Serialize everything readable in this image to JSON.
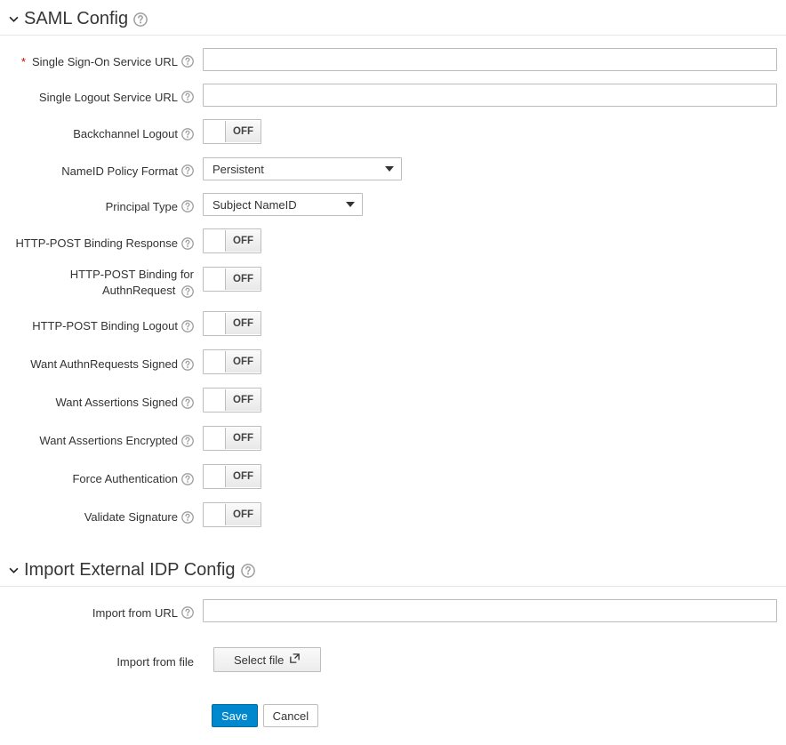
{
  "toggle_off": "OFF",
  "sections": {
    "saml": {
      "title": "SAML Config"
    },
    "import": {
      "title": "Import External IDP Config"
    }
  },
  "saml": {
    "sso_url": {
      "label": "Single Sign-On Service URL",
      "value": "",
      "required": true
    },
    "slo_url": {
      "label": "Single Logout Service URL",
      "value": ""
    },
    "backchannel_logout": {
      "label": "Backchannel Logout"
    },
    "nameid_policy_format": {
      "label": "NameID Policy Format",
      "value": "Persistent"
    },
    "principal_type": {
      "label": "Principal Type",
      "value": "Subject NameID"
    },
    "http_post_response": {
      "label": "HTTP-POST Binding Response"
    },
    "http_post_authn": {
      "label_line1": "HTTP-POST Binding for",
      "label_line2": "AuthnRequest"
    },
    "http_post_logout": {
      "label": "HTTP-POST Binding Logout"
    },
    "want_authnreq_signed": {
      "label": "Want AuthnRequests Signed"
    },
    "want_assertions_signed": {
      "label": "Want Assertions Signed"
    },
    "want_assertions_encrypted": {
      "label": "Want Assertions Encrypted"
    },
    "force_authentication": {
      "label": "Force Authentication"
    },
    "validate_signature": {
      "label": "Validate Signature"
    }
  },
  "import": {
    "from_url": {
      "label": "Import from URL",
      "value": ""
    },
    "from_file": {
      "label": "Import from file",
      "button": "Select file"
    }
  },
  "buttons": {
    "save": "Save",
    "cancel": "Cancel"
  }
}
